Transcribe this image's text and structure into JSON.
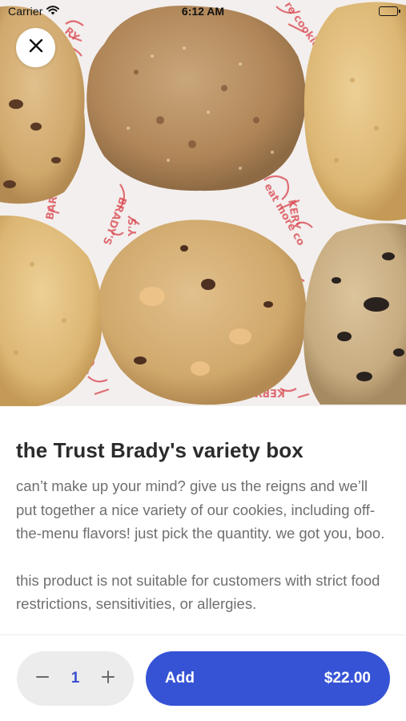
{
  "status_bar": {
    "carrier": "Carrier",
    "time": "6:12 AM"
  },
  "hero": {
    "image": "cookies-box-photo",
    "bg_color": "#f4f1ef"
  },
  "product": {
    "title": "the Trust Brady's variety box",
    "description": [
      "can’t make up your mind? give us the reigns and we’ll put together a nice variety of our cookies, including off-the-menu flavors! just pick the quantity. we got you, boo.",
      "this product is not suitable for customers with strict food restrictions, sensitivities, or allergies."
    ]
  },
  "cart": {
    "quantity": "1",
    "add_label": "Add",
    "price": "$22.00"
  },
  "colors": {
    "accent": "#3653d6",
    "title": "#2b2b2b",
    "body_text": "#6f6f6f",
    "stepper_bg": "#ececec"
  },
  "icons": {
    "close": "close-icon",
    "minus": "minus-icon",
    "plus": "plus-icon",
    "wifi": "wifi-icon",
    "battery": "battery-icon"
  }
}
